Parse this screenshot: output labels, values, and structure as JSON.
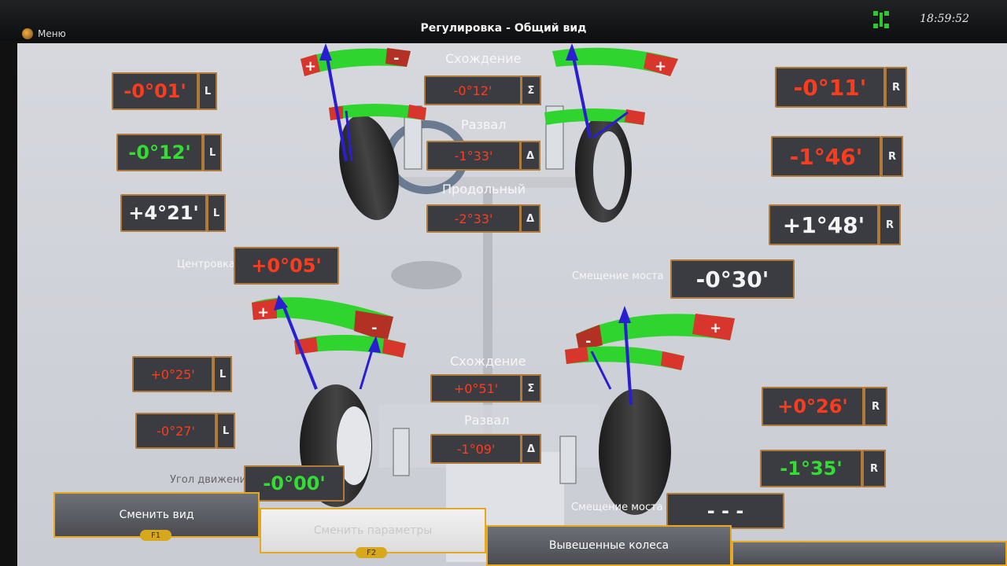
{
  "window": {
    "menu_label": "Меню",
    "title": "Регулировка - Общий вид",
    "clock": "18:59:52"
  },
  "front": {
    "left_toe": "-0°01'",
    "left_camber": "-0°12'",
    "left_caster": "+4°21'",
    "right_toe": "-0°11'",
    "right_camber": "-1°46'",
    "right_caster": "+1°48'",
    "total_toe_label": "Схождение",
    "total_toe": "-0°12'",
    "camber_label": "Развал",
    "camber_diff": "-1°33'",
    "caster_label": "Продольный",
    "caster_diff": "-2°33'",
    "centering_label": "Центровка",
    "centering": "+0°05'",
    "setback_label": "Смещение моста",
    "setback": "-0°30'"
  },
  "rear": {
    "left_toe": "+0°25'",
    "left_camber": "-0°27'",
    "right_toe": "+0°26'",
    "right_camber": "-1°35'",
    "total_toe_label": "Схождение",
    "total_toe": "+0°51'",
    "camber_label": "Развал",
    "camber_diff": "-1°09'",
    "thrust_label": "Угол движения",
    "thrust": "-0°00'",
    "setback_label": "Смещение моста",
    "setback": "- - -"
  },
  "tags": {
    "left": "L",
    "right": "R",
    "sum": "Σ",
    "delta": "Δ"
  },
  "gauge": {
    "plus": "+",
    "minus": "-"
  },
  "toolbar": {
    "change_view": "Сменить вид",
    "change_view_key": "F1",
    "change_params": "Сменить параметры",
    "change_params_key": "F2",
    "lifted_wheels": "Вывешенные колеса"
  },
  "colors": {
    "good": "#33dd33",
    "bad": "#ff3b1d",
    "border": "#b07a3a",
    "arrow": "#2a1fd0"
  }
}
